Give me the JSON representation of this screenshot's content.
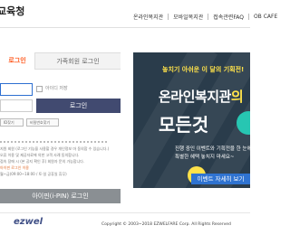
{
  "header": {
    "brand": "교육청",
    "nav": [
      "온라인복지관",
      "모바일복지관",
      "접속관련FAQ",
      "OB CAFE"
    ]
  },
  "login": {
    "tab_active": "로그인",
    "tab_inactive": "가족회원 로그인",
    "save_id_label": "아이디 저장",
    "login_button": "로그인",
    "small_btn_1": "ID찾기",
    "small_btn_2": "비밀번호찾기",
    "notes": [
      "지원 회원 (로그인 기능을 사용할 경우 개인정보 마 동의합 수 있습니다.)",
      "오류 이용 및 제공자료에 의한 고객 사례 동의합니다.",
      "접속 장애 시 (본 공지 확인 후) 회원자 문의 가능합니다.",
      "아이핀 로그인 이용",
      "월~금(09:00~18:00 / 토·일 공휴일 휴무)"
    ],
    "ipin_button": "아이핀(i-PIN) 로그인"
  },
  "banner": {
    "top_text": "놓치기 아쉬운 이 달의 기획전!",
    "line1_a": "온라인복지관",
    "line1_b": "의",
    "line2": "모든것",
    "desc1": "진행 중인 이벤트와 기획전을 한 눈에",
    "desc2": "특별한 혜택 놓치지 마세요~",
    "cta": "이벤트 자세히 보기",
    "colors": {
      "bg": "#2a3c4b",
      "accent": "#ffe24a",
      "teal": "#27c6b2",
      "cta": "#2f73d1"
    }
  },
  "footer": {
    "logo": "ezwel",
    "copyright": "Copyright © 2003~2018 EZWELFARE Corp. All Rights Reserved"
  }
}
